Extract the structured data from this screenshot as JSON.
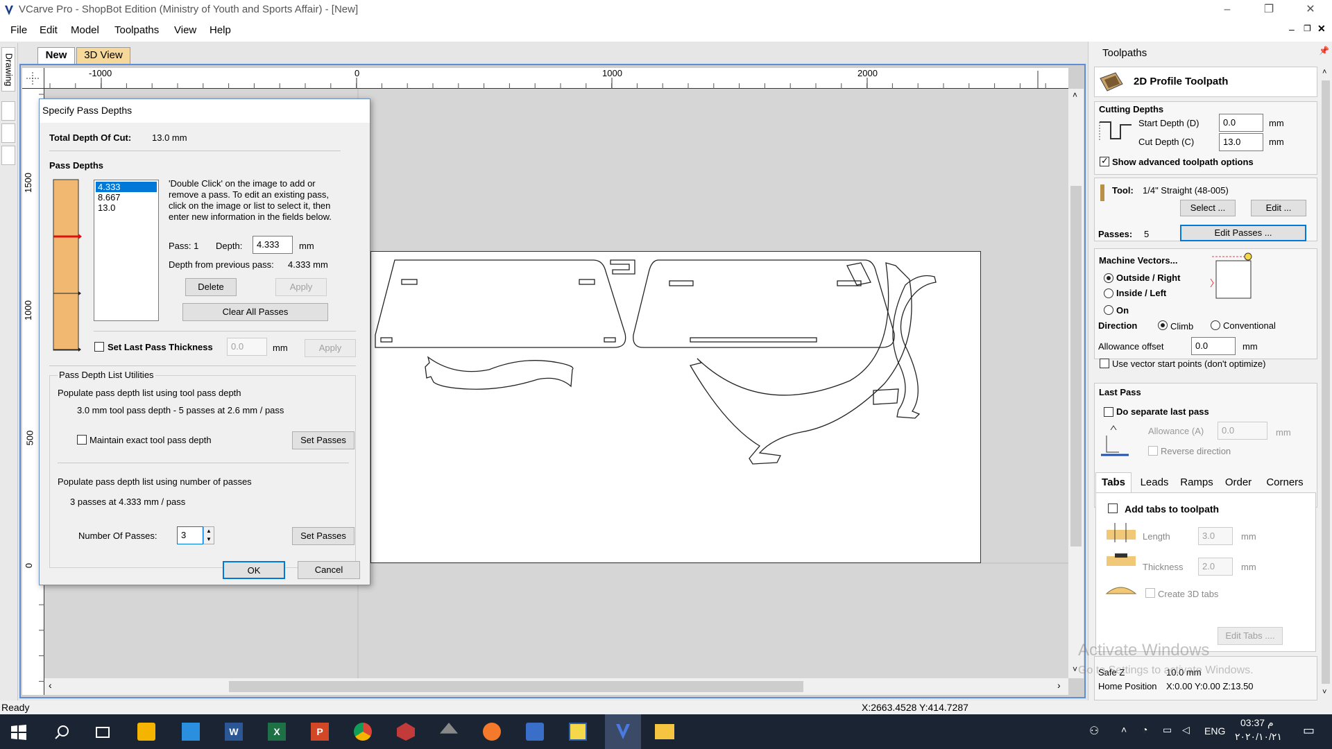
{
  "window": {
    "title": "VCarve Pro - ShopBot Edition (Ministry of Youth and Sports Affair) - [New]"
  },
  "menu": [
    "File",
    "Edit",
    "Model",
    "Toolpaths",
    "View",
    "Help"
  ],
  "doc_tabs": {
    "new": "New",
    "view3d": "3D View"
  },
  "left_strip_label": "Drawing",
  "ruler": {
    "h_ticks": [
      "-1000",
      "0",
      "1000",
      "2000"
    ],
    "v_ticks": [
      "1500",
      "1000",
      "500",
      "0"
    ]
  },
  "dialog": {
    "title": "Specify Pass Depths",
    "total_label": "Total Depth Of Cut:",
    "total_value": "13.0 mm",
    "pass_depths_heading": "Pass Depths",
    "pass_list": [
      "4.333",
      "8.667",
      "13.0"
    ],
    "instructions": "'Double Click' on the image to add or remove a pass. To edit an existing pass, click on the image or list to select it, then enter new information in the fields below.",
    "pass_label": "Pass: 1",
    "depth_label": "Depth:",
    "depth_value": "4.333",
    "depth_unit": "mm",
    "prev_label": "Depth from previous pass:",
    "prev_value": "4.333 mm",
    "delete_btn": "Delete",
    "apply_btn": "Apply",
    "clear_btn": "Clear All Passes",
    "set_last_label": "Set Last Pass Thickness",
    "set_last_value": "0.0",
    "set_last_unit": "mm",
    "set_last_apply": "Apply",
    "utilities_heading": "Pass Depth List Utilities",
    "util1_text": "Populate pass depth list using tool pass depth",
    "util1_detail": "3.0 mm tool pass depth - 5 passes at 2.6 mm / pass",
    "maintain_label": "Maintain exact tool pass depth",
    "set_passes_btn": "Set Passes",
    "util2_text": "Populate pass depth list using number of passes",
    "util2_detail": "3 passes at 4.333 mm / pass",
    "num_passes_label": "Number Of Passes:",
    "num_passes_value": "3",
    "set_passes_btn2": "Set Passes",
    "ok_btn": "OK",
    "cancel_btn": "Cancel"
  },
  "panel": {
    "title": "Toolpaths",
    "toolpath_title": "2D Profile Toolpath",
    "cutting_depths": "Cutting Depths",
    "start_depth_label": "Start Depth (D)",
    "start_depth_value": "0.0",
    "cut_depth_label": "Cut Depth (C)",
    "cut_depth_value": "13.0",
    "unit": "mm",
    "show_adv": "Show advanced toolpath options",
    "tool_label": "Tool:",
    "tool_value": "1/4\" Straight  (48-005)",
    "select_btn": "Select ...",
    "edit_btn": "Edit ...",
    "passes_label": "Passes:",
    "passes_value": "5",
    "edit_passes_btn": "Edit Passes ...",
    "machine_vectors": "Machine Vectors...",
    "outside": "Outside / Right",
    "inside": "Inside / Left",
    "on": "On",
    "direction": "Direction",
    "climb": "Climb",
    "conventional": "Conventional",
    "allowance_label": "Allowance offset",
    "allowance_value": "0.0",
    "vector_start": "Use vector start points (don't optimize)",
    "last_pass": "Last Pass",
    "separate_last": "Do separate last pass",
    "allowance_a_label": "Allowance (A)",
    "allowance_a_value": "0.0",
    "reverse": "Reverse direction",
    "tabs": [
      "Tabs",
      "Leads",
      "Ramps",
      "Order",
      "Corners"
    ],
    "add_tabs": "Add tabs to toolpath",
    "length_label": "Length",
    "length_value": "3.0",
    "thickness_label": "Thickness",
    "thickness_value": "2.0",
    "create3d": "Create 3D tabs",
    "edit_tabs_btn": "Edit Tabs ....",
    "safe_z_label": "Safe Z",
    "safe_z_value": "10.0 mm",
    "home_label": "Home Position",
    "home_value": "X:0.00 Y:0.00 Z:13.50",
    "watermark1": "Activate Windows",
    "watermark2": "Go to Settings to activate Windows."
  },
  "status": {
    "left": "Ready",
    "coords": "X:2663.4528 Y:414.7287"
  },
  "taskbar": {
    "lang": "ENG",
    "time": "03:37 م",
    "date": "٢٠٢٠/١٠/٢١"
  },
  "colors": {
    "accent": "#5b8dd8",
    "taskbar": "#1b2433",
    "wood": "#f0b870"
  }
}
